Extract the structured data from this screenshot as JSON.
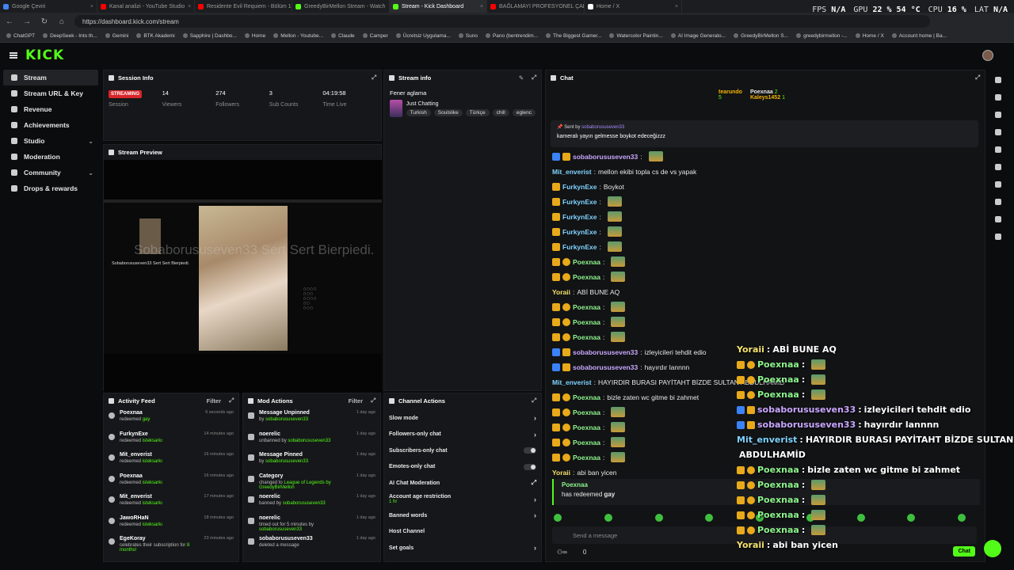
{
  "tabs": [
    {
      "label": "Google Çeviri",
      "color": "#4285f4"
    },
    {
      "label": "Kanal analizi - YouTube Studio",
      "color": "#ff0000"
    },
    {
      "label": "Residente Evil Requiem - Bölüm 1",
      "color": "#ff0000"
    },
    {
      "label": "GreedyBirMellon Stream - Watch",
      "color": "#53fc18"
    },
    {
      "label": "Stream - Kick Dashboard",
      "color": "#53fc18",
      "active": true
    },
    {
      "label": "BAĞLAMAYI PROFESYONEL ÇALM",
      "color": "#ff0000"
    },
    {
      "label": "Home / X",
      "color": "#ffffff"
    }
  ],
  "hud": {
    "fps_label": "FPS",
    "fps": "N/A",
    "gpu_label": "GPU",
    "gpu": "22 %  54 °C",
    "cpu_label": "CPU",
    "cpu": "16 %",
    "lat_label": "LAT",
    "lat": "N/A"
  },
  "url": "https://dashboard.kick.com/stream",
  "bookmarks": [
    "ChatGPT",
    "DeepSeek - Into th...",
    "Gemini",
    "BTK Akademi",
    "Sapphire | Dashbo...",
    "Home",
    "Mellon - Youtube...",
    "Claude",
    "Camper",
    "Ücretsiz Uygulama...",
    "Suno",
    "Pano (bentrendim...",
    "The Biggest Gamer...",
    "Watercolor Paintin...",
    "AI Image Generato...",
    "GreedyBirMellon S...",
    "greedybirmellon -...",
    "Home / X",
    "Account home | Ba..."
  ],
  "logo": "KICK",
  "sidebar": [
    {
      "label": "Stream",
      "active": true
    },
    {
      "label": "Stream URL & Key"
    },
    {
      "label": "Revenue"
    },
    {
      "label": "Achievements"
    },
    {
      "label": "Studio",
      "chev": true
    },
    {
      "label": "Moderation"
    },
    {
      "label": "Community",
      "chev": true
    },
    {
      "label": "Drops & rewards"
    }
  ],
  "session": {
    "title": "Session Info",
    "badge": "STREAMING",
    "stats": [
      {
        "n": "",
        "l": "Session"
      },
      {
        "n": "14",
        "l": "Viewers"
      },
      {
        "n": "274",
        "l": "Followers"
      },
      {
        "n": "3",
        "l": "Sub Counts"
      },
      {
        "n": "04:19:58",
        "l": "Time Live"
      }
    ]
  },
  "preview": {
    "title": "Stream Preview",
    "ghost": "Sobaborususeven33 Sert Sert Bierpiedi.",
    "cap": "Sobaborususeven33 Sert Sert Bierpiedi."
  },
  "streaminfo": {
    "title": "Stream info",
    "stream_title": "Fener aglama",
    "category": "Just Chatting",
    "tags": [
      "Turkish",
      "Soulslike",
      "Türkçe",
      "chill",
      "eglenc"
    ]
  },
  "activity": {
    "title": "Activity Feed",
    "filter": "Filter",
    "rows": [
      {
        "user": "Poexnaa",
        "pre": "redeemed",
        "hl": "gay",
        "time": "6 seconds ago"
      },
      {
        "user": "FurkynExe",
        "pre": "redeemed",
        "hl": "isteksarkı",
        "time": "14 minutes ago"
      },
      {
        "user": "Mit_enverist",
        "pre": "redeemed",
        "hl": "isteksarkı",
        "time": "16 minutes ago"
      },
      {
        "user": "Poexnaa",
        "pre": "redeemed",
        "hl": "isteksarkı",
        "time": "16 minutes ago"
      },
      {
        "user": "Mit_enverist",
        "pre": "redeemed",
        "hl": "isteksarkı",
        "time": "17 minutes ago"
      },
      {
        "user": "JawoRHaN",
        "pre": "redeemed",
        "hl": "isteksarkı",
        "time": "18 minutes ago"
      },
      {
        "user": "EgeKoray",
        "pre": "celebrates their subscription for",
        "hl": "8 months!",
        "time": "23 minutes ago"
      }
    ]
  },
  "mod": {
    "title": "Mod Actions",
    "filter": "Filter",
    "rows": [
      {
        "a": "Message Unpinned",
        "pre": "by",
        "hl": "sobaborususeven33",
        "time": "1 day ago"
      },
      {
        "a": "noerelic",
        "pre": "unbanned by",
        "hl": "sobaborususeven33",
        "time": "1 day ago"
      },
      {
        "a": "Message Pinned",
        "pre": "by",
        "hl": "sobaborususeven33",
        "time": "1 day ago"
      },
      {
        "a": "Category",
        "pre": "changed to",
        "hl": "League of Legends by GreedyBirMellon",
        "time": "1 day ago"
      },
      {
        "a": "noerelic",
        "pre": "banned by",
        "hl": "sobaborususeven33",
        "time": "1 day ago"
      },
      {
        "a": "noerelic",
        "pre": "timed out for 5 minutes by",
        "hl": "sobaborususeven33",
        "time": "1 day ago"
      },
      {
        "a": "sobaborususeven33",
        "pre": "deleted a message",
        "hl": "",
        "time": "1 day ago"
      }
    ]
  },
  "channel": {
    "title": "Channel Actions",
    "rows": [
      {
        "l": "Slow mode",
        "k": "chev"
      },
      {
        "l": "Followers-only chat",
        "k": "chev"
      },
      {
        "l": "Subscribers-only chat",
        "k": "toggle"
      },
      {
        "l": "Emotes-only chat",
        "k": "toggle"
      },
      {
        "l": "AI Chat Moderation",
        "k": "ext"
      },
      {
        "l": "Account age restriction",
        "sub": "1 hr",
        "k": "chev"
      },
      {
        "l": "Banned words",
        "k": "chev"
      },
      {
        "l": "Host Channel",
        "k": ""
      },
      {
        "l": "Set goals",
        "k": "chev"
      }
    ]
  },
  "chat": {
    "title": "Chat",
    "leader": {
      "a": "tearundo",
      "an": "5",
      "b": "Poexnaa",
      "bn": "2",
      "c": "Kaleys1452",
      "cn": "1"
    },
    "pinned": {
      "sent": "Sent by",
      "user": "sobaborususeven33",
      "text": "kameralı yayın gelmesse boykot edeceğizzz"
    },
    "messages": [
      {
        "u": "sobaborususeven33",
        "c": "#c9a7ff",
        "b": "b3",
        "t": "",
        "e": true
      },
      {
        "u": "Mit_enverist",
        "c": "#7fd3ff",
        "b": "",
        "t": "mellon ekibi topla cs de vs yapak"
      },
      {
        "u": "FurkynExe",
        "c": "#7fd3ff",
        "b": "b1",
        "t": "Boykot"
      },
      {
        "u": "FurkynExe",
        "c": "#7fd3ff",
        "b": "b1",
        "t": "",
        "e": true
      },
      {
        "u": "FurkynExe",
        "c": "#7fd3ff",
        "b": "b1",
        "t": "",
        "e": true
      },
      {
        "u": "FurkynExe",
        "c": "#7fd3ff",
        "b": "b1",
        "t": "",
        "e": true
      },
      {
        "u": "FurkynExe",
        "c": "#7fd3ff",
        "b": "b1",
        "t": "",
        "e": true
      },
      {
        "u": "Poexnaa",
        "c": "#8ef58e",
        "b": "b12",
        "t": "",
        "e": true
      },
      {
        "u": "Poexnaa",
        "c": "#8ef58e",
        "b": "b12",
        "t": "",
        "e": true
      },
      {
        "u": "Yoraii",
        "c": "#f5e26b",
        "b": "",
        "t": "ABİ BUNE AQ"
      },
      {
        "u": "Poexnaa",
        "c": "#8ef58e",
        "b": "b12",
        "t": "",
        "e": true
      },
      {
        "u": "Poexnaa",
        "c": "#8ef58e",
        "b": "b12",
        "t": "",
        "e": true
      },
      {
        "u": "Poexnaa",
        "c": "#8ef58e",
        "b": "b12",
        "t": "",
        "e": true
      },
      {
        "u": "sobaborususeven33",
        "c": "#c9a7ff",
        "b": "b3",
        "t": "izleyicileri tehdit edio"
      },
      {
        "u": "sobaborususeven33",
        "c": "#c9a7ff",
        "b": "b3",
        "t": "hayırdır lannnn"
      },
      {
        "u": "Mit_enverist",
        "c": "#7fd3ff",
        "b": "",
        "t": "HAYIRDIR BURASI PAYİTAHT BİZDE SULTAN ABDULHAMİD"
      },
      {
        "u": "Poexnaa",
        "c": "#8ef58e",
        "b": "b12",
        "t": "bizle zaten wc gitme bi zahmet"
      },
      {
        "u": "Poexnaa",
        "c": "#8ef58e",
        "b": "b12",
        "t": "",
        "e": true
      },
      {
        "u": "Poexnaa",
        "c": "#8ef58e",
        "b": "b12",
        "t": "",
        "e": true
      },
      {
        "u": "Poexnaa",
        "c": "#8ef58e",
        "b": "b12",
        "t": "",
        "e": true
      },
      {
        "u": "Poexnaa",
        "c": "#8ef58e",
        "b": "b12",
        "t": "",
        "e": true
      },
      {
        "u": "Yoraii",
        "c": "#f5e26b",
        "b": "",
        "t": "abi ban yicen"
      }
    ],
    "redeem": {
      "user": "Poexnaa",
      "pre": "has redeemed",
      "hl": "gay"
    },
    "placeholder": "Send a message",
    "viewers": "0",
    "chat_btn": "Chat"
  },
  "overlay": [
    {
      "u": "Yoraii",
      "c": "#f5e26b",
      "t": "ABİ BUNE AQ",
      "b": ""
    },
    {
      "u": "Poexnaa",
      "c": "#8ef58e",
      "t": "",
      "b": "b12",
      "e": true
    },
    {
      "u": "Poexnaa",
      "c": "#8ef58e",
      "t": "",
      "b": "b12",
      "e": true
    },
    {
      "u": "Poexnaa",
      "c": "#8ef58e",
      "t": "",
      "b": "b12",
      "e": true
    },
    {
      "u": "sobaborususeven33",
      "c": "#c9a7ff",
      "t": "izleyicileri tehdit edio",
      "b": "b3"
    },
    {
      "u": "sobaborususeven33",
      "c": "#c9a7ff",
      "t": "hayırdır lannnn",
      "b": "b3"
    },
    {
      "u": "Mit_enverist",
      "c": "#7fd3ff",
      "t": "HAYIRDIR BURASI PAYİTAHT BİZDE SULTAN",
      "b": ""
    },
    {
      "u": "",
      "c": "#fff",
      "t": "ABDULHAMİD",
      "b": ""
    },
    {
      "u": "Poexnaa",
      "c": "#8ef58e",
      "t": "bizle zaten wc gitme bi zahmet",
      "b": "b12"
    },
    {
      "u": "Poexnaa",
      "c": "#8ef58e",
      "t": "",
      "b": "b12",
      "e": true
    },
    {
      "u": "Poexnaa",
      "c": "#8ef58e",
      "t": "",
      "b": "b12",
      "e": true
    },
    {
      "u": "Poexnaa",
      "c": "#8ef58e",
      "t": "",
      "b": "b12",
      "e": true
    },
    {
      "u": "Poexnaa",
      "c": "#8ef58e",
      "t": "",
      "b": "b12",
      "e": true
    },
    {
      "u": "Yoraii",
      "c": "#f5e26b",
      "t": "abi ban yicen",
      "b": ""
    }
  ]
}
